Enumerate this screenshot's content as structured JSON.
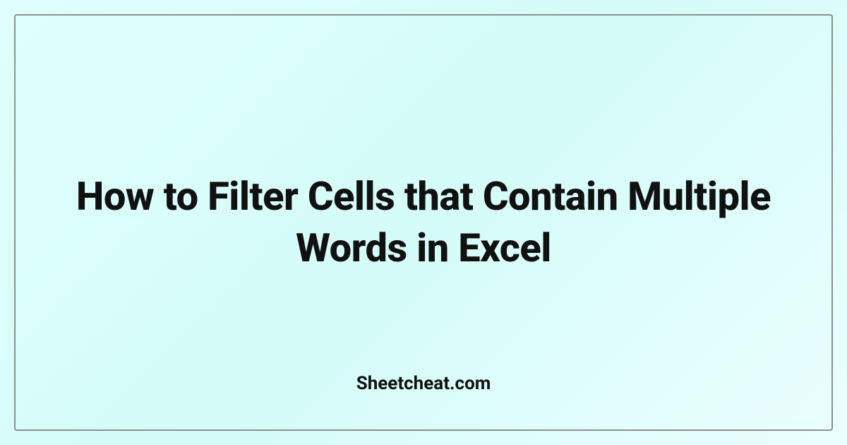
{
  "card": {
    "title": "How to Filter Cells that Contain Multiple Words in Excel",
    "siteName": "Sheetcheat.com"
  }
}
